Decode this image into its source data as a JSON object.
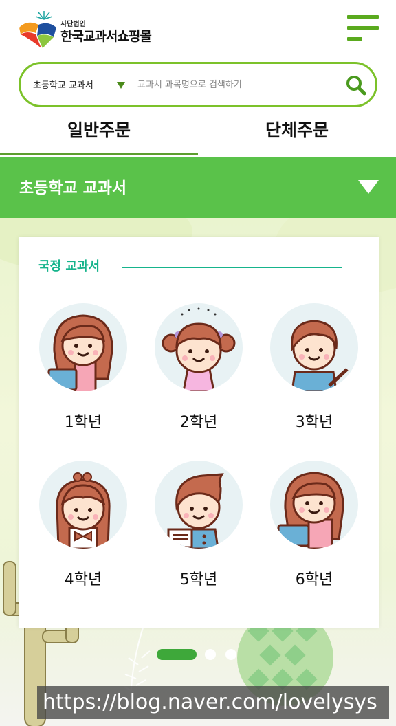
{
  "header": {
    "logo_small": "사단법인",
    "logo_main": "한국교과서쇼핑몰",
    "menu_icon": "hamburger-menu-icon"
  },
  "search": {
    "category": "초등학교 교과서",
    "placeholder": "교과서 과목명으로 검색하기",
    "value": "",
    "button_icon": "search-icon"
  },
  "tabs": [
    {
      "label": "일반주문",
      "active": true
    },
    {
      "label": "단체주문",
      "active": false
    }
  ],
  "category_bar": {
    "title": "초등학교 교과서",
    "icon": "triangle-down-icon"
  },
  "card": {
    "heading": "국정 교과서",
    "grades": [
      {
        "label": "1학년"
      },
      {
        "label": "2학년"
      },
      {
        "label": "3학년"
      },
      {
        "label": "4학년"
      },
      {
        "label": "5학년"
      },
      {
        "label": "6학년"
      }
    ]
  },
  "pagination": {
    "active": 1,
    "total": 3
  },
  "colors": {
    "accent_green": "#5ac24a",
    "search_border": "#7cc22a",
    "teal": "#16b48c"
  },
  "watermark": "https://blog.naver.com/lovelysys"
}
